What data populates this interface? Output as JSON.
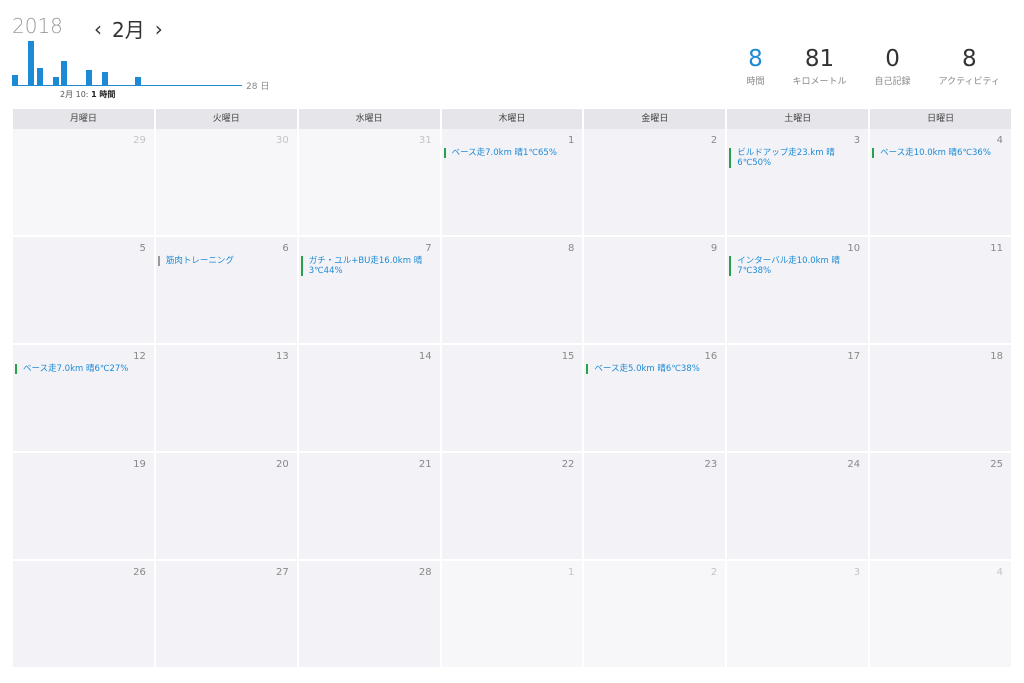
{
  "header": {
    "year": "2018",
    "month": "2月",
    "prev_icon": "‹",
    "next_icon": "›"
  },
  "sparkline": {
    "end_label": "28 日",
    "note_prefix": "2月 10:",
    "note_value": "1 時間",
    "bars": [
      {
        "day": 1,
        "value": 0.25
      },
      {
        "day": 3,
        "value": 1.0
      },
      {
        "day": 4,
        "value": 0.4
      },
      {
        "day": 6,
        "value": 0.2
      },
      {
        "day": 7,
        "value": 0.55
      },
      {
        "day": 10,
        "value": 0.35
      },
      {
        "day": 12,
        "value": 0.3
      },
      {
        "day": 16,
        "value": 0.2
      }
    ],
    "color": "#1d8ad6"
  },
  "stats": [
    {
      "value": "8",
      "label": "時間",
      "accent": true
    },
    {
      "value": "81",
      "label": "キロメートル",
      "accent": false
    },
    {
      "value": "0",
      "label": "自己記録",
      "accent": false
    },
    {
      "value": "8",
      "label": "アクティビティ",
      "accent": false
    }
  ],
  "weekdays": [
    "月曜日",
    "火曜日",
    "水曜日",
    "木曜日",
    "金曜日",
    "土曜日",
    "日曜日"
  ],
  "days": [
    {
      "date": "29",
      "out": true,
      "events": []
    },
    {
      "date": "30",
      "out": true,
      "events": []
    },
    {
      "date": "31",
      "out": true,
      "events": []
    },
    {
      "date": "1",
      "out": false,
      "events": [
        {
          "text": "ベース走7.0km 晴1℃65%",
          "type": "run"
        }
      ]
    },
    {
      "date": "2",
      "out": false,
      "events": []
    },
    {
      "date": "3",
      "out": false,
      "events": [
        {
          "text": "ビルドアップ走23.km 晴6℃50%",
          "type": "run"
        }
      ]
    },
    {
      "date": "4",
      "out": false,
      "events": [
        {
          "text": "ベース走10.0km 晴6℃36%",
          "type": "run"
        }
      ]
    },
    {
      "date": "5",
      "out": false,
      "events": []
    },
    {
      "date": "6",
      "out": false,
      "events": [
        {
          "text": "筋肉トレーニング",
          "type": "strength"
        }
      ]
    },
    {
      "date": "7",
      "out": false,
      "events": [
        {
          "text": "ガチ・ユル+BU走16.0km 晴3℃44%",
          "type": "run"
        }
      ]
    },
    {
      "date": "8",
      "out": false,
      "events": []
    },
    {
      "date": "9",
      "out": false,
      "events": []
    },
    {
      "date": "10",
      "out": false,
      "events": [
        {
          "text": "インターバル走10.0km 晴7℃38%",
          "type": "run"
        }
      ]
    },
    {
      "date": "11",
      "out": false,
      "events": []
    },
    {
      "date": "12",
      "out": false,
      "events": [
        {
          "text": "ベース走7.0km 晴6℃27%",
          "type": "run"
        }
      ]
    },
    {
      "date": "13",
      "out": false,
      "events": []
    },
    {
      "date": "14",
      "out": false,
      "events": []
    },
    {
      "date": "15",
      "out": false,
      "events": []
    },
    {
      "date": "16",
      "out": false,
      "events": [
        {
          "text": "ベース走5.0km 晴6℃38%",
          "type": "run"
        }
      ]
    },
    {
      "date": "17",
      "out": false,
      "events": []
    },
    {
      "date": "18",
      "out": false,
      "events": []
    },
    {
      "date": "19",
      "out": false,
      "events": []
    },
    {
      "date": "20",
      "out": false,
      "events": []
    },
    {
      "date": "21",
      "out": false,
      "events": []
    },
    {
      "date": "22",
      "out": false,
      "events": []
    },
    {
      "date": "23",
      "out": false,
      "events": []
    },
    {
      "date": "24",
      "out": false,
      "events": []
    },
    {
      "date": "25",
      "out": false,
      "events": []
    },
    {
      "date": "26",
      "out": false,
      "events": []
    },
    {
      "date": "27",
      "out": false,
      "events": []
    },
    {
      "date": "28",
      "out": false,
      "events": []
    },
    {
      "date": "1",
      "out": true,
      "events": []
    },
    {
      "date": "2",
      "out": true,
      "events": []
    },
    {
      "date": "3",
      "out": true,
      "events": []
    },
    {
      "date": "4",
      "out": true,
      "events": []
    }
  ]
}
